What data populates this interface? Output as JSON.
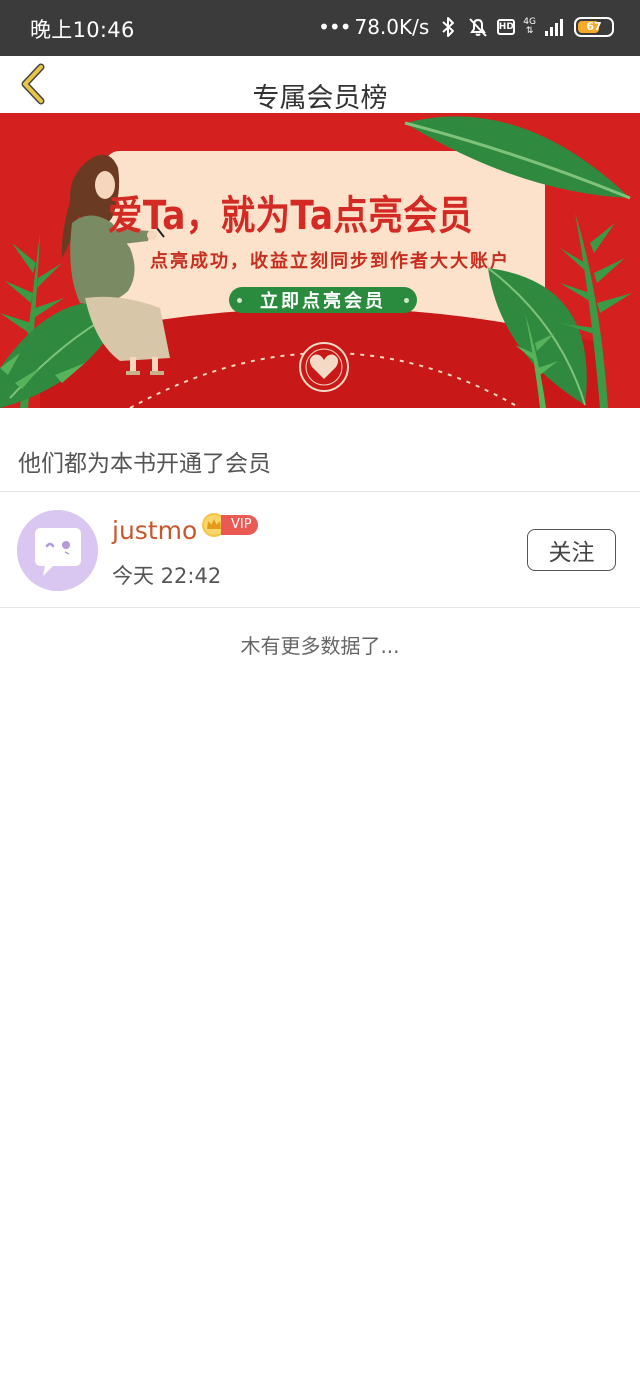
{
  "status_bar": {
    "time": "晚上10:46",
    "network_speed": "78.0K/s",
    "network_type": "4G",
    "hd_label": "HD",
    "battery": "67",
    "battery_level": 0.67
  },
  "header": {
    "title": "专属会员榜"
  },
  "banner": {
    "headline": "爱Ta，就为Ta点亮会员",
    "subtitle": "点亮成功，收益立刻同步到作者大大账户",
    "cta": "立即点亮会员"
  },
  "section": {
    "title": "他们都为本书开通了会员"
  },
  "members": [
    {
      "name": "justmo",
      "badge": "VIP",
      "time": "今天 22:42",
      "follow_label": "关注"
    }
  ],
  "footer": {
    "no_more": "木有更多数据了..."
  },
  "colors": {
    "status_bar_bg": "#3b3b3b",
    "banner_red": "#d52020",
    "banner_paper": "#fde2cb",
    "cta_green": "#2a8a3e",
    "username": "#c9572c",
    "vip_badge": "#ea5a52",
    "avatar_bg": "#d9c7f2",
    "back_arrow": "#e8c547"
  },
  "icons": [
    "chevron-left-icon",
    "bluetooth-icon",
    "bell-off-icon",
    "signal-icon",
    "battery-icon",
    "crown-icon",
    "chat-bubble-avatar-icon",
    "heart-seal-icon"
  ]
}
